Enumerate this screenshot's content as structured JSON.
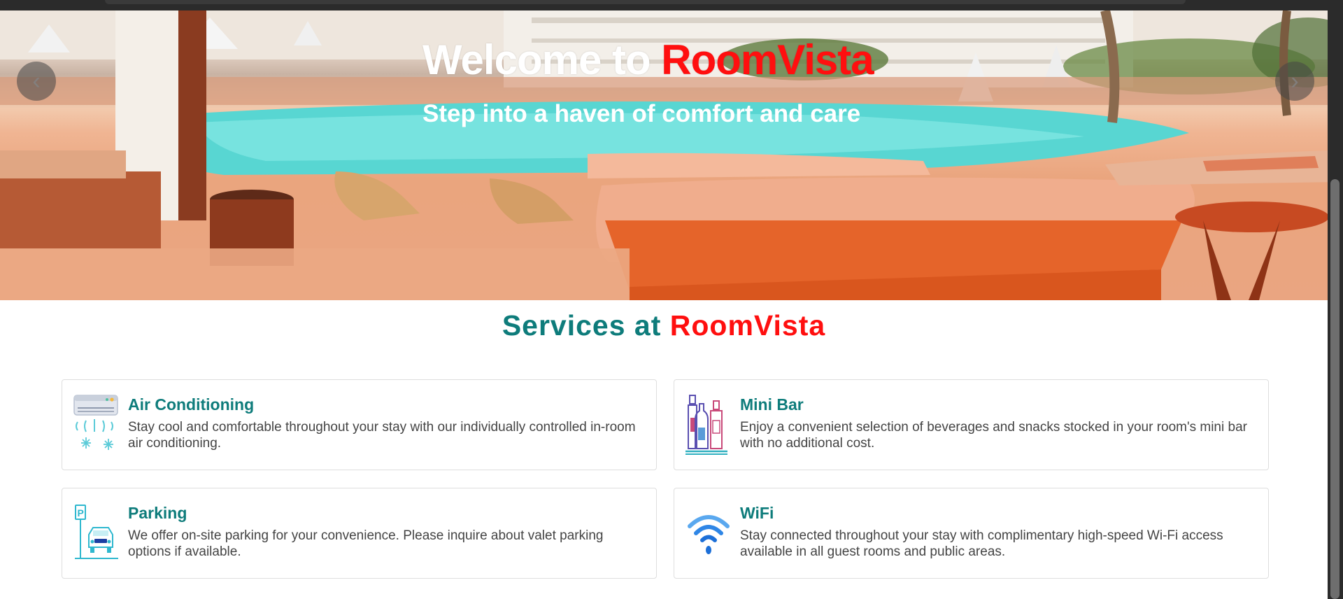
{
  "hero": {
    "title_prefix": "Welcome to ",
    "title_brand": "RoomVista",
    "subtitle": "Step into a haven of comfort and care",
    "prev_icon": "chevron-left-icon",
    "next_icon": "chevron-right-icon",
    "prev_glyph": "‹",
    "next_glyph": "›"
  },
  "services": {
    "title_prefix": "Services at ",
    "title_brand": "RoomVista",
    "cards": [
      {
        "icon": "air-conditioner-icon",
        "title": "Air Conditioning",
        "description": "Stay cool and comfortable throughout your stay with our individually controlled in-room air conditioning."
      },
      {
        "icon": "mini-bar-bottles-icon",
        "title": "Mini Bar",
        "description": "Enjoy a convenient selection of beverages and snacks stocked in your room's mini bar with no additional cost."
      },
      {
        "icon": "parking-car-icon",
        "title": "Parking",
        "description": "We offer on-site parking for your convenience. Please inquire about valet parking options if available."
      },
      {
        "icon": "wifi-icon",
        "title": "WiFi",
        "description": "Stay connected throughout your stay with complimentary high-speed Wi-Fi access available in all guest rooms and public areas."
      }
    ]
  },
  "colors": {
    "accent_teal": "#0e7c7b",
    "brand_red": "#ff0f0f",
    "text_gray": "#444444",
    "card_border": "#dedede"
  }
}
